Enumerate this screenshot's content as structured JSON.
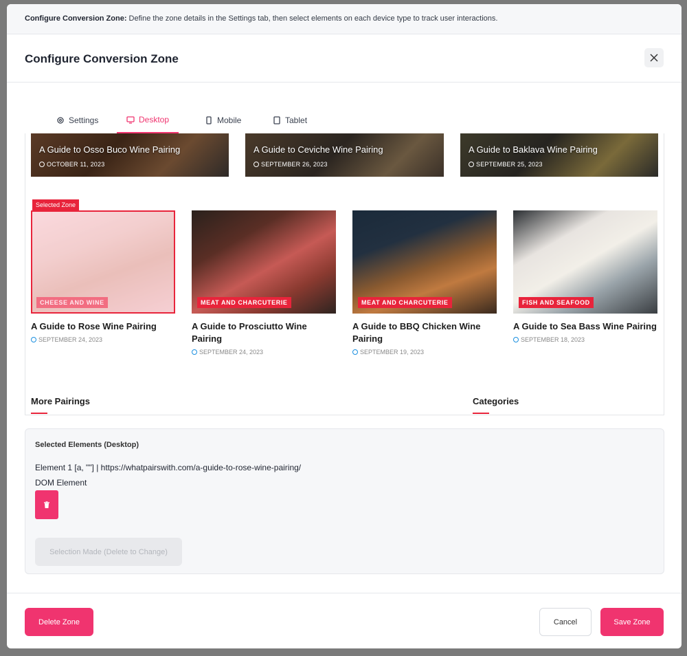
{
  "info_bar": {
    "label": "Configure Conversion Zone:",
    "text": " Define the zone details in the Settings tab, then select elements on each device type to track user interactions."
  },
  "header": {
    "title": "Configure Conversion Zone",
    "close_icon": "close-icon"
  },
  "tabs": [
    {
      "label": "Settings",
      "icon": "gear-icon",
      "active": false
    },
    {
      "label": "Desktop",
      "icon": "monitor-icon",
      "active": true
    },
    {
      "label": "Mobile",
      "icon": "phone-icon",
      "active": false
    },
    {
      "label": "Tablet",
      "icon": "tablet-icon",
      "active": false
    }
  ],
  "preview": {
    "banners": [
      {
        "title": "A Guide to Osso Buco Wine Pairing",
        "date": "OCTOBER 11, 2023"
      },
      {
        "title": "A Guide to Ceviche Wine Pairing",
        "date": "SEPTEMBER 26, 2023"
      },
      {
        "title": "A Guide to Baklava Wine Pairing",
        "date": "SEPTEMBER 25, 2023"
      }
    ],
    "selected_tag": "Selected Zone",
    "cards": [
      {
        "category": "CHEESE AND WINE",
        "title": "A Guide to Rose Wine Pairing",
        "date": "SEPTEMBER 24, 2023"
      },
      {
        "category": "MEAT AND CHARCUTERIE",
        "title": "A Guide to Prosciutto Wine Pairing",
        "date": "SEPTEMBER 24, 2023"
      },
      {
        "category": "MEAT AND CHARCUTERIE",
        "title": "A Guide to BBQ Chicken Wine Pairing",
        "date": "SEPTEMBER 19, 2023"
      },
      {
        "category": "FISH AND SEAFOOD",
        "title": "A Guide to Sea Bass Wine Pairing",
        "date": "SEPTEMBER 18, 2023"
      }
    ],
    "sections": {
      "more": "More Pairings",
      "categories": "Categories"
    }
  },
  "selected_elements": {
    "title": "Selected Elements (Desktop)",
    "element_1": "Element 1 [a, \"\"] | https://whatpairswith.com/a-guide-to-rose-wine-pairing/",
    "dom_label": "DOM Element",
    "selection_made": "Selection Made (Delete to Change)"
  },
  "footer": {
    "delete": "Delete Zone",
    "cancel": "Cancel",
    "save": "Save Zone"
  },
  "colors": {
    "accent": "#f0346f",
    "zone_red": "#e8243b"
  }
}
